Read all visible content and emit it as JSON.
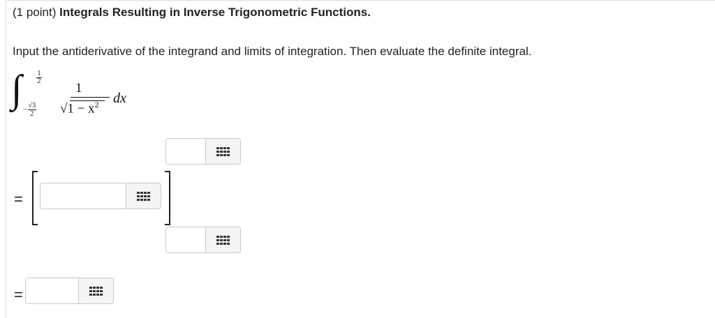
{
  "header": {
    "points": "(1 point)",
    "title": "Integrals Resulting in Inverse Trigonometric Functions."
  },
  "instructions": "Input the antiderivative of the integrand and limits of integration. Then evaluate the definite integral.",
  "integral": {
    "upper_limit_num": "1",
    "upper_limit_den": "2",
    "lower_limit_sign": "−",
    "lower_limit_num": "√3",
    "lower_limit_den": "2",
    "numerator": "1",
    "denominator": "√1 − x",
    "denominator_exp": "2",
    "differential": "dx"
  },
  "equals_sign": "=",
  "inputs": {
    "upper_limit_value": "",
    "antiderivative_value": "",
    "lower_limit_value": "",
    "result_value": ""
  },
  "icons": {
    "keyboard": "keyboard-grid-icon"
  }
}
